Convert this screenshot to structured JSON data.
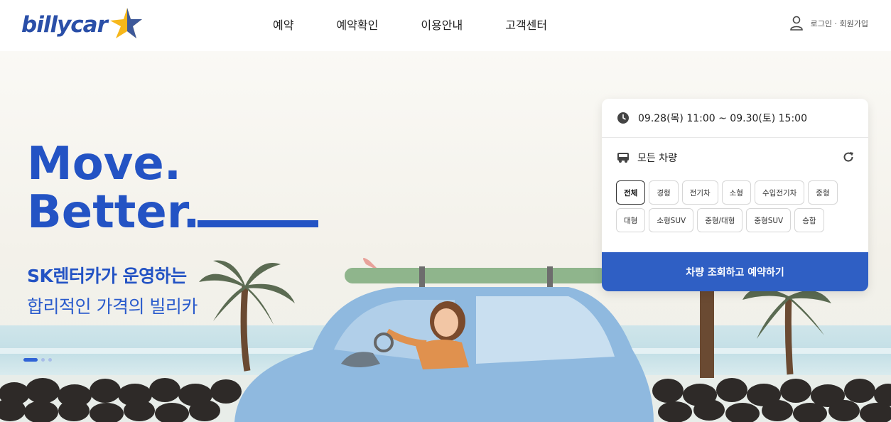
{
  "header": {
    "logo_text": "billycar",
    "nav": [
      "예약",
      "예약확인",
      "이용안내",
      "고객센터"
    ],
    "user_link": "로그인 · 회원가입"
  },
  "hero": {
    "headline_line1": "Move.",
    "headline_line2": "Better.",
    "subtitle_bold": "SK렌터카가 운영하는",
    "subtitle": "합리적인 가격의 빌리카",
    "slide_count": 3,
    "active_slide": 1
  },
  "booking": {
    "date_range": "09.28(목) 11:00 ~ 09.30(토) 15:00",
    "vehicle_label": "모든 차량",
    "chips": [
      "전체",
      "경형",
      "전기차",
      "소형",
      "수입전기차",
      "중형",
      "대형",
      "소형SUV",
      "중형/대형",
      "중형SUV",
      "승합"
    ],
    "selected_chip": "전체",
    "cta_label": "차량 조회하고 예약하기"
  },
  "colors": {
    "brand_blue": "#2a4fa8",
    "accent_blue": "#2f5fc4",
    "star_yellow": "#f6b71a"
  },
  "icons": [
    "star-logo-icon",
    "user-icon",
    "clock-icon",
    "car-icon",
    "refresh-icon"
  ]
}
